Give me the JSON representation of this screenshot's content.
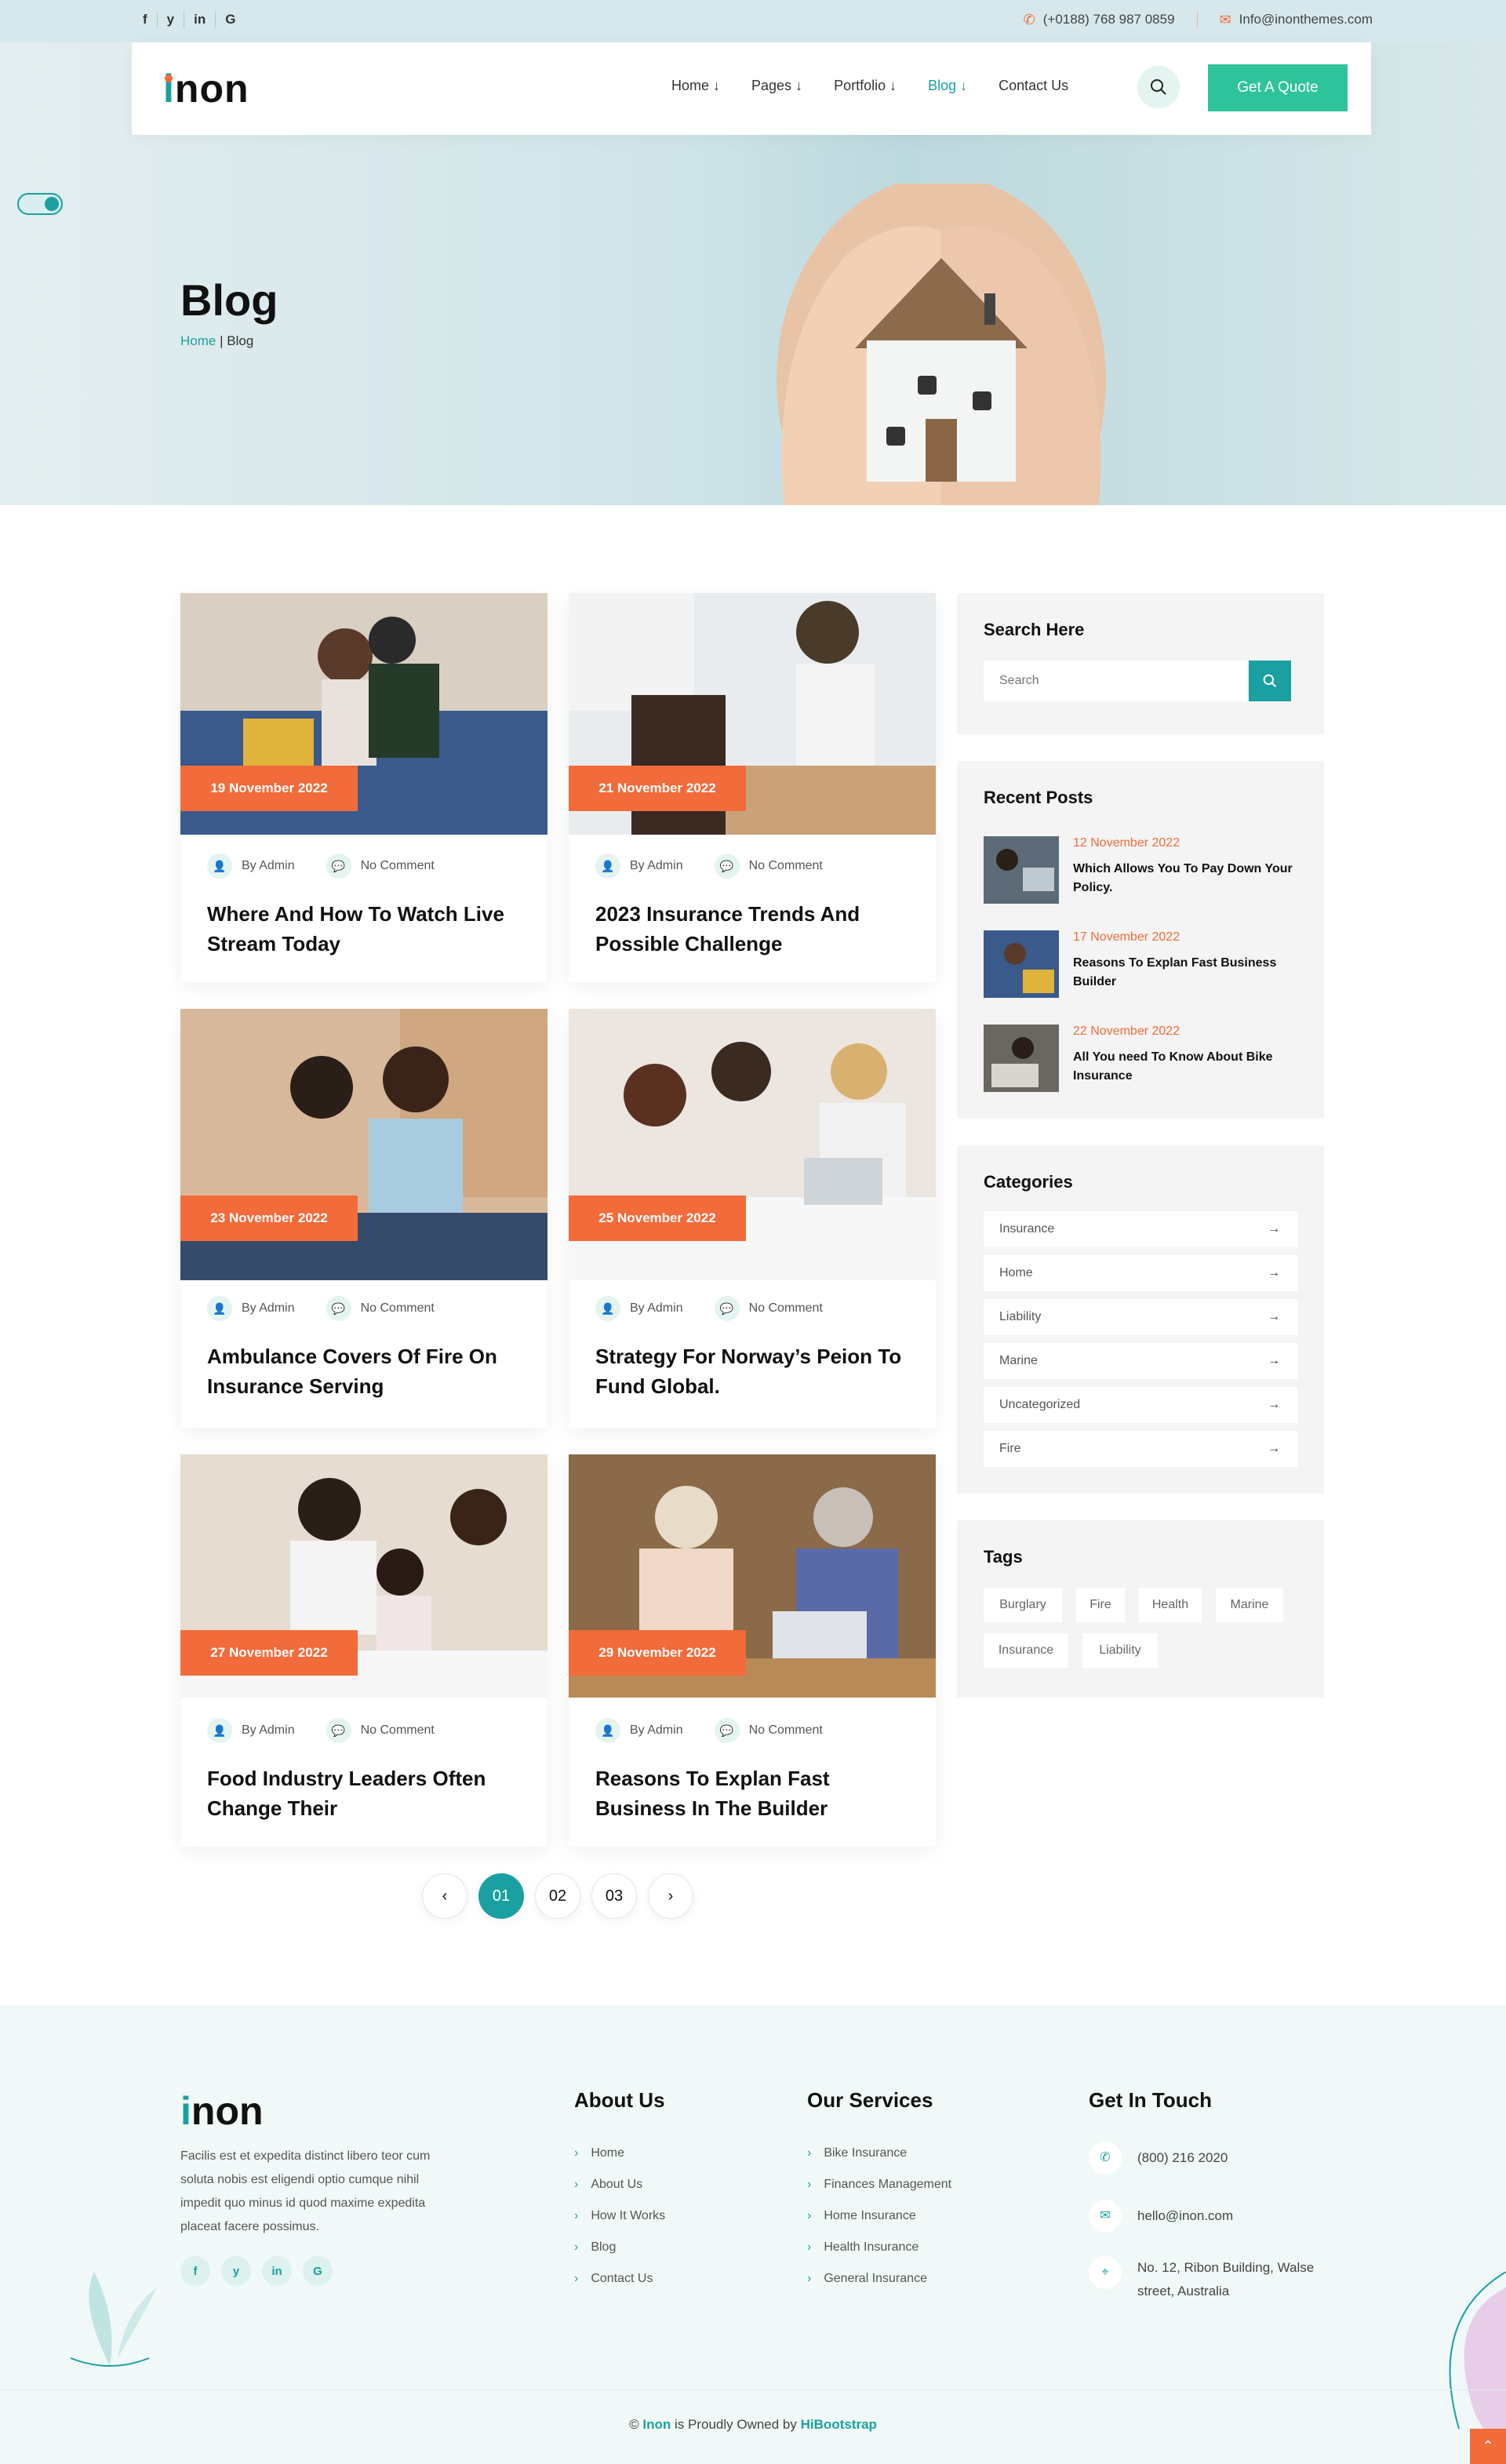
{
  "topbar": {
    "social": [
      "f",
      "y",
      "in",
      "G"
    ],
    "phone": "(+0188) 768 987 0859",
    "email": "Info@inonthemes.com"
  },
  "header": {
    "logo": "non",
    "logo_i": "i",
    "nav": [
      "Home ↓",
      "Pages ↓",
      "Portfolio ↓",
      "Blog ↓",
      "Contact Us"
    ],
    "quote_label": "Get A Quote"
  },
  "hero": {
    "title": "Blog",
    "breadcrumb_home": "Home",
    "breadcrumb_sep": "|",
    "breadcrumb_current": "Blog"
  },
  "posts": [
    {
      "date": "19 November 2022",
      "author": "By Admin",
      "comments": "No Comment",
      "title": "Where And How To Watch Live Stream Today"
    },
    {
      "date": "21 November 2022",
      "author": "By Admin",
      "comments": "No Comment",
      "title": "2023 Insurance Trends And Possible Challenge"
    },
    {
      "date": "23 November 2022",
      "author": "By Admin",
      "comments": "No Comment",
      "title": "Ambulance Covers Of Fire On Insurance Serving"
    },
    {
      "date": "25 November 2022",
      "author": "By Admin",
      "comments": "No Comment",
      "title": "Strategy For Norway’s Peion To Fund Global."
    },
    {
      "date": "27 November 2022",
      "author": "By Admin",
      "comments": "No Comment",
      "title": "Food Industry Leaders Often Change Their"
    },
    {
      "date": "29 November 2022",
      "author": "By Admin",
      "comments": "No Comment",
      "title": "Reasons To Explan Fast Business In The Builder"
    }
  ],
  "pagination": {
    "prev": "‹",
    "pages": [
      "01",
      "02",
      "03"
    ],
    "next": "›",
    "current": "01"
  },
  "sidebar": {
    "search_title": "Search Here",
    "search_placeholder": "Search",
    "recent_title": "Recent Posts",
    "recent": [
      {
        "date": "12 November 2022",
        "title": "Which Allows You To Pay Down Your Policy."
      },
      {
        "date": "17 November 2022",
        "title": "Reasons To Explan Fast Business Builder"
      },
      {
        "date": "22 November 2022",
        "title": "All You need To Know About Bike Insurance"
      }
    ],
    "categories_title": "Categories",
    "categories": [
      "Insurance",
      "Home",
      "Liability",
      "Marine",
      "Uncategorized",
      "Fire"
    ],
    "tags_title": "Tags",
    "tags": [
      "Burglary",
      "Fire",
      "Health",
      "Marine",
      "Insurance",
      "Liability"
    ]
  },
  "footer": {
    "logo": "non",
    "logo_i": "i",
    "desc": "Facilis est et expedita distinct libero teor cum soluta nobis est eligendi optio cumque nihil impedit quo minus id quod maxime expedita placeat facere possimus.",
    "social": [
      "f",
      "y",
      "in",
      "G"
    ],
    "about_title": "About Us",
    "about_links": [
      "Home",
      "About Us",
      "How It Works",
      "Blog",
      "Contact Us"
    ],
    "services_title": "Our Services",
    "services_links": [
      "Bike Insurance",
      "Finances Management",
      "Home Insurance",
      "Health Insurance",
      "General Insurance"
    ],
    "contact_title": "Get In Touch",
    "phone": "(800) 216 2020",
    "email": "hello@inon.com",
    "address": "No. 12, Ribon Building, Walse street, Australia",
    "copyright_pre": "©",
    "copyright_brand": "Inon",
    "copyright_mid": "is Proudly Owned by",
    "copyright_owner": "HiBootstrap"
  },
  "colors": {
    "accent": "#1aa0a0",
    "brand_orange": "#f26b3a",
    "green_button": "#2ec39a"
  }
}
